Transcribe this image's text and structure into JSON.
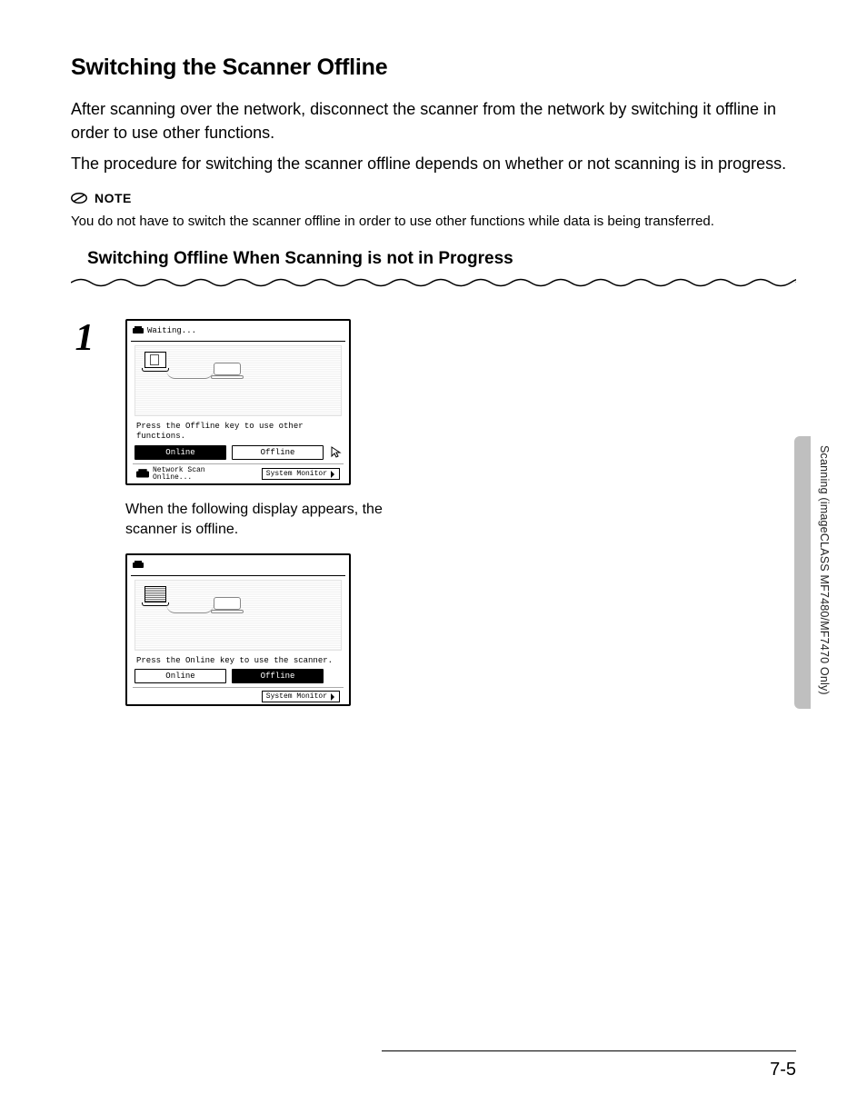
{
  "heading": "Switching the Scanner Offline",
  "intro1": "After scanning over the network, disconnect the scanner from the network by switching it offline in order to use other functions.",
  "intro2": "The procedure for switching the scanner offline depends on whether or not scanning is in progress.",
  "note": {
    "label": "NOTE",
    "text": "You do not have to switch the scanner offline in order to use other functions while data is being transferred."
  },
  "subheading": "Switching Offline When Scanning is not in Progress",
  "step_number": "1",
  "panel1": {
    "title": "Waiting...",
    "instruction": "Press the Offline key to use other functions.",
    "btn_online": "Online",
    "btn_offline": "Offline",
    "footer_line1": "Network Scan",
    "footer_line2": "Online...",
    "sysmon": "System Monitor"
  },
  "caption": "When the following display appears, the scanner is offline.",
  "panel2": {
    "title": "",
    "instruction": "Press the Online key to use the scanner.",
    "btn_online": "Online",
    "btn_offline": "Offline",
    "sysmon": "System Monitor"
  },
  "side_label": "Scanning (imageCLASS MF7480/MF7470 Only)",
  "page_number": "7-5"
}
